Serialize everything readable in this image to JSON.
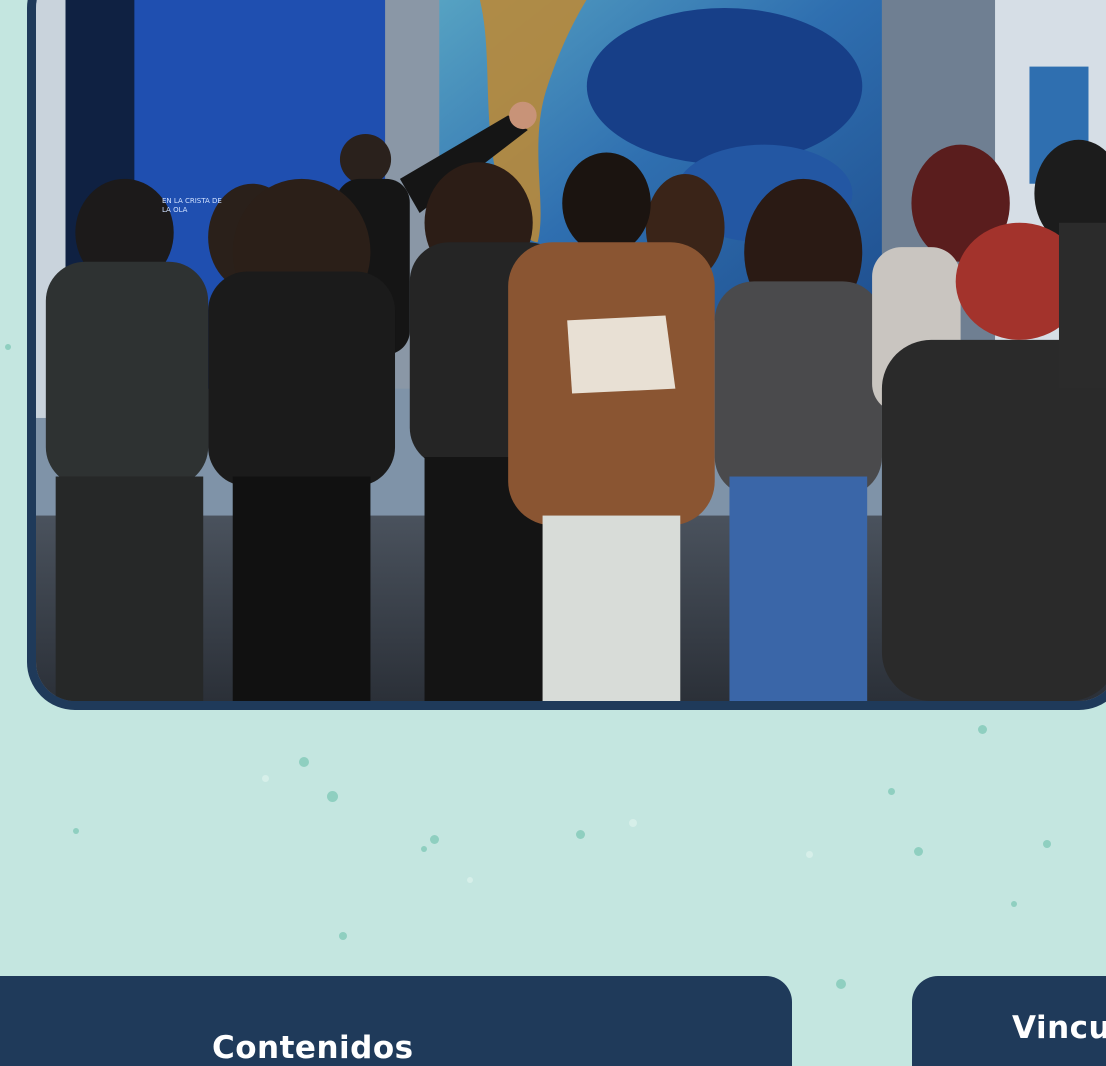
{
  "photo": {
    "description_icon": "photo-image",
    "frame_color": "#1f3a5a",
    "sign_text": "EN LA CRISTA DE LA OLA"
  },
  "cards": [
    {
      "title": "Contenidos"
    },
    {
      "title": "Vincu"
    }
  ],
  "colors": {
    "background": "#c4e6e0",
    "card": "#1f3a5a",
    "dots": "#8fcfc0"
  }
}
